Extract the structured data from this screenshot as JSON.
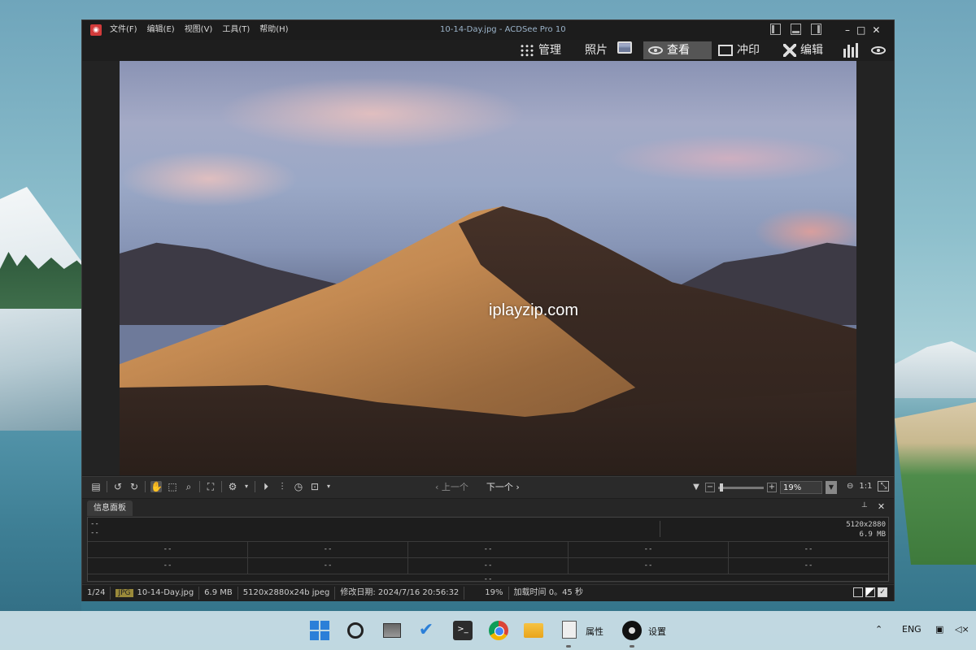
{
  "window": {
    "title": "10-14-Day.jpg - ACDSee Pro 10",
    "app_logo_icon": "camera-icon",
    "minimize": "–",
    "maximize": "□",
    "close": "✕"
  },
  "menu": {
    "items": [
      "文件(F)",
      "编辑(E)",
      "视图(V)",
      "工具(T)",
      "帮助(H)"
    ]
  },
  "modes": [
    {
      "label": "管理",
      "icon": "grid-icon",
      "active": false
    },
    {
      "label": "照片",
      "icon": "photos-icon",
      "active": false
    },
    {
      "label": "查看",
      "icon": "eye-icon",
      "active": true
    },
    {
      "label": "冲印",
      "icon": "develop-icon",
      "active": false
    },
    {
      "label": "编辑",
      "icon": "edit-tools-icon",
      "active": false
    }
  ],
  "viewer": {
    "watermark": "iplayzip.com"
  },
  "toolbar": {
    "prev_label": "上一个",
    "next_label": "下一个",
    "zoom_value": "19%",
    "ratio_label": "1:1"
  },
  "info_panel": {
    "tab_label": "信息面板",
    "pin": "📌",
    "close": "✕",
    "line1": "--",
    "line2": "--",
    "dimensions": "5120x2880",
    "size": "6.9 MB",
    "grid_row1": [
      "--",
      "--",
      "--",
      "--",
      "--"
    ],
    "grid_row2": [
      "--",
      "--",
      "--",
      "--",
      "--"
    ],
    "grid_last": "--"
  },
  "status": {
    "index": "1/24",
    "format_badge": "JPG",
    "filename": "10-14-Day.jpg",
    "filesize": "6.9 MB",
    "dims": "5120x2880x24b jpeg",
    "modified": "修改日期: 2024/7/16 20:56:32",
    "zoom": "19%",
    "load_time": "加载时间 0。45 秒"
  },
  "taskbar": {
    "props_label": "属性",
    "settings_label": "设置",
    "lang": "ENG"
  }
}
